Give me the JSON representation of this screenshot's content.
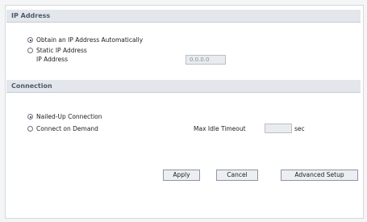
{
  "ip_section": {
    "title": "IP Address",
    "obtain_auto_label": "Obtain an IP Address Automatically",
    "static_label": "Static IP Address",
    "ip_address_label": "IP Address",
    "ip_address_value": "0.0.0.0",
    "selected": "obtain_auto"
  },
  "connection_section": {
    "title": "Connection",
    "nailed_up_label": "Nailed-Up Connection",
    "on_demand_label": "Connect on Demand",
    "max_idle_label": "Max Idle Timeout",
    "max_idle_value": "",
    "sec_label": "sec",
    "selected": "nailed_up"
  },
  "buttons": {
    "apply": "Apply",
    "cancel": "Cancel",
    "advanced": "Advanced Setup"
  }
}
